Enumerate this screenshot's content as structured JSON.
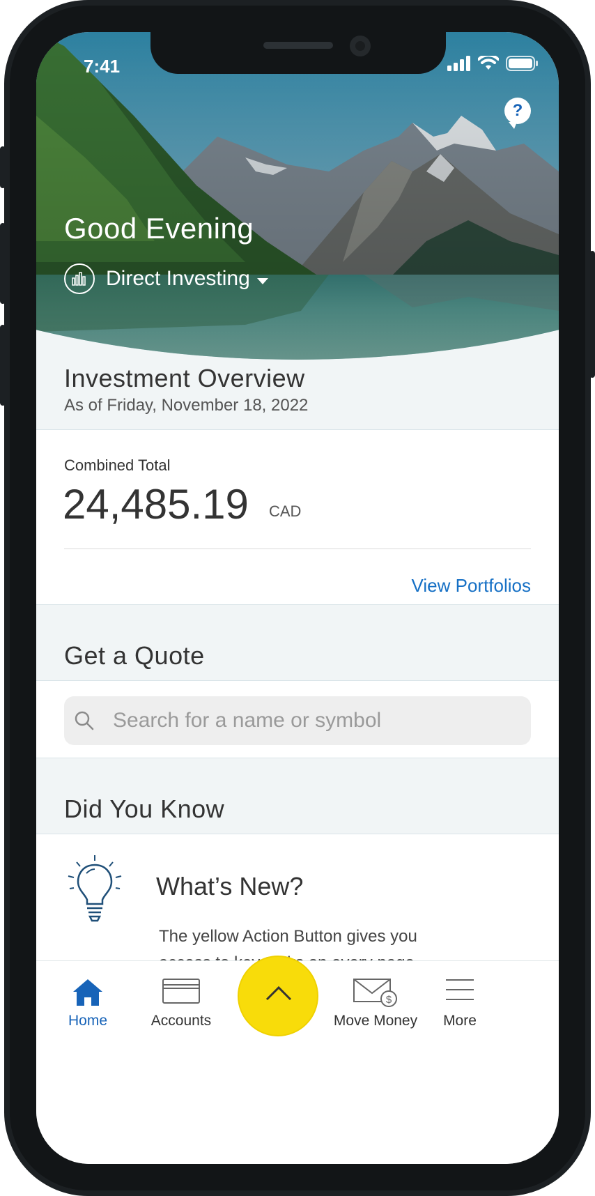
{
  "status_bar": {
    "time": "7:41"
  },
  "hero": {
    "greeting": "Good Evening",
    "context_label": "Direct Investing",
    "help_label": "?"
  },
  "overview": {
    "title": "Investment Overview",
    "as_of": "As of Friday, November 18, 2022",
    "combined_label": "Combined Total",
    "combined_value": "24,485.19",
    "currency": "CAD",
    "link_label": "View Portfolios"
  },
  "quote": {
    "title": "Get a Quote",
    "search_placeholder": "Search for a name or symbol"
  },
  "did_you_know": {
    "title": "Did You Know",
    "card_title": "What’s New?",
    "card_body": "The yellow Action Button gives you access to key tasks on every page"
  },
  "tab_bar": {
    "items": [
      {
        "label": "Home",
        "icon": "home-icon",
        "active": true
      },
      {
        "label": "Accounts",
        "icon": "card-icon",
        "active": false
      },
      {
        "label": "Move Money",
        "icon": "envelope-dollar-icon",
        "active": false
      },
      {
        "label": "More",
        "icon": "hamburger-icon",
        "active": false
      }
    ],
    "action_button_icon": "chevron-up-icon"
  },
  "colors": {
    "accent_blue": "#1763b8",
    "link_blue": "#1670c5",
    "action_yellow": "#f8dc0a",
    "section_bg": "#f1f5f6"
  }
}
